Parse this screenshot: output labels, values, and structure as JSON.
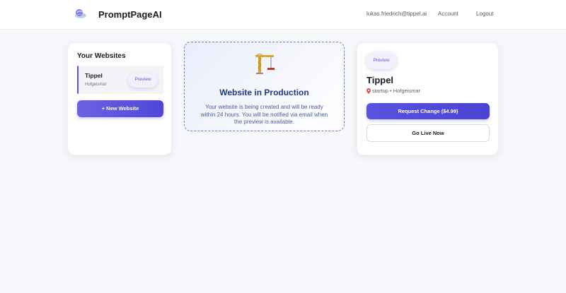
{
  "header": {
    "brand": "PromptPageAI",
    "email": "lukas.friedrich@tippel.ai",
    "account": "Account",
    "logout": "Logout"
  },
  "left": {
    "title": "Your Websites",
    "sites": [
      {
        "name": "Tippel",
        "location": "Hofgeismar",
        "action": "Preview"
      }
    ],
    "new_button": "+ New Website"
  },
  "middle": {
    "icon": "construction-crane-icon",
    "title": "Website in Production",
    "description": "Your website is being created and will be ready within 24 hours. You will be notified via email when the preview is available."
  },
  "right": {
    "preview": "Preview",
    "title": "Tippel",
    "meta": "startup • Hofgeismar",
    "request_button": "Request Change ($4.99)",
    "golive_button": "Go Live Now"
  },
  "colors": {
    "accent": "#4f46d8",
    "heading_blue": "#1e3a8a",
    "dashed_border": "#6f78c9"
  }
}
